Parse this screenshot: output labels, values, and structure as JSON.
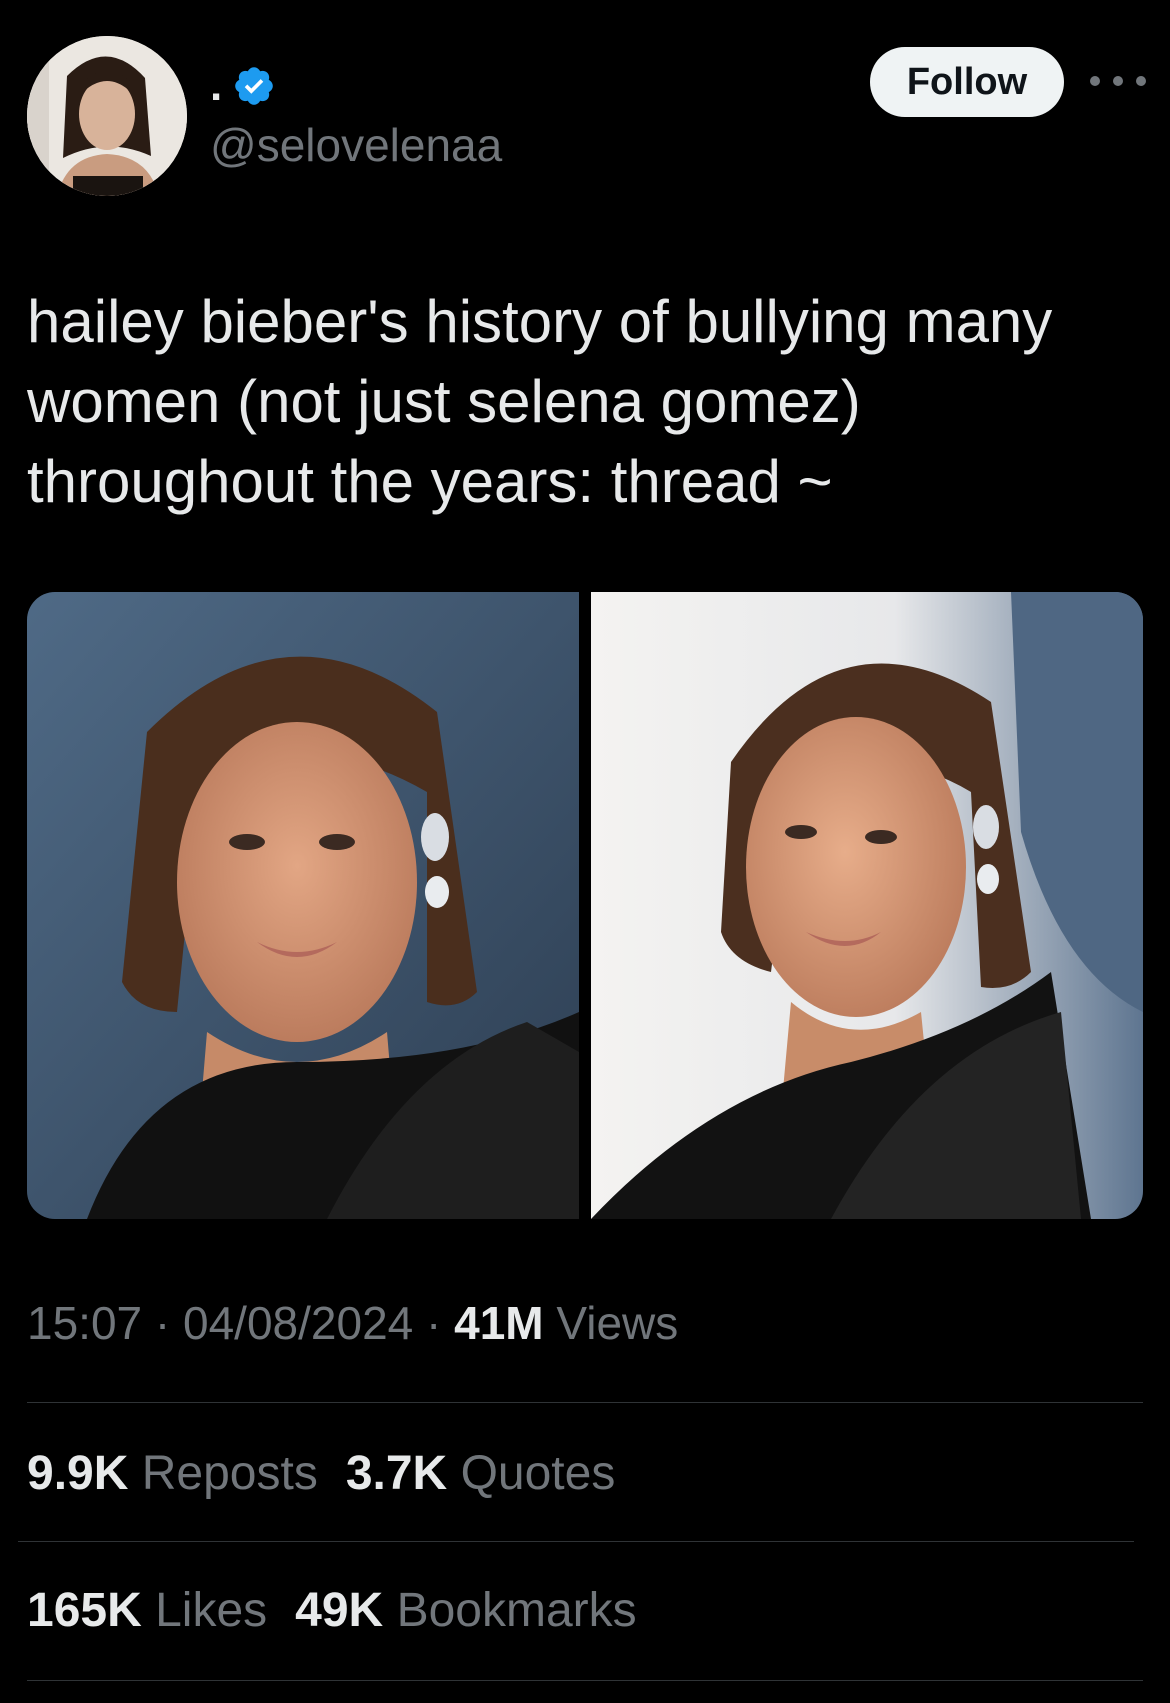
{
  "author": {
    "display_name": ".",
    "handle": "@selovelenaa",
    "verified": true,
    "follow_label": "Follow"
  },
  "tweet": {
    "text": "hailey bieber's history of bullying many\nwomen (not just selena gomez)\nthroughout the years: thread ~"
  },
  "meta": {
    "time": "15:07",
    "separator": "·",
    "date": "04/08/2024",
    "views_count": "41M",
    "views_label": "Views"
  },
  "stats": {
    "reposts_count": "9.9K",
    "reposts_label": "Reposts",
    "quotes_count": "3.7K",
    "quotes_label": "Quotes",
    "likes_count": "165K",
    "likes_label": "Likes",
    "bookmarks_count": "49K",
    "bookmarks_label": "Bookmarks"
  },
  "icons": {
    "verified": "verified-badge-icon",
    "more": "more-options-icon"
  },
  "colors": {
    "background": "#000000",
    "text_primary": "#e7e9ea",
    "text_secondary": "#71767b",
    "verified_blue": "#1d9bf0",
    "divider": "#2f3336",
    "follow_bg": "#eff3f4"
  }
}
